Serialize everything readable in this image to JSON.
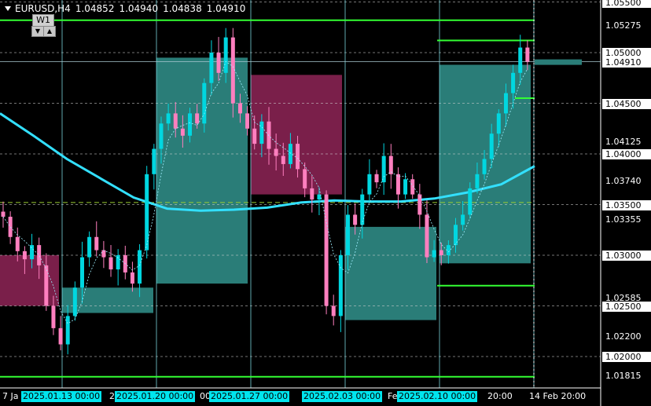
{
  "header": {
    "symbol": "EURUSD,H4",
    "open": "1.04852",
    "high": "1.04940",
    "low": "1.04838",
    "close": "1.04910"
  },
  "timeframe_box": {
    "label": "W1",
    "down_icon": "▼",
    "up_icon": "▲"
  },
  "price_scale": {
    "labels": [
      {
        "text": "1.05500",
        "boxed": true
      },
      {
        "text": "1.05275",
        "boxed": false
      },
      {
        "text": "1.05000",
        "boxed": true
      },
      {
        "text": "1.04910",
        "boxed": true,
        "current": true
      },
      {
        "text": "1.04500",
        "boxed": true
      },
      {
        "text": "1.04125",
        "boxed": false
      },
      {
        "text": "1.04000",
        "boxed": true
      },
      {
        "text": "1.03740",
        "boxed": false
      },
      {
        "text": "1.03500",
        "boxed": true
      },
      {
        "text": "1.03355",
        "boxed": false
      },
      {
        "text": "1.03000",
        "boxed": true
      },
      {
        "text": "1.02585",
        "boxed": false
      },
      {
        "text": "1.02500",
        "boxed": true
      },
      {
        "text": "1.02200",
        "boxed": false
      },
      {
        "text": "1.02000",
        "boxed": true
      },
      {
        "text": "1.01815",
        "boxed": false
      }
    ]
  },
  "time_scale": {
    "labels": [
      {
        "text": "7 Ja",
        "highlight": false
      },
      {
        "text": "2025.01.13 00:00",
        "highlight": true
      },
      {
        "text": "2",
        "highlight": false
      },
      {
        "text": "2025.01.20 00:00",
        "highlight": true
      },
      {
        "text": "00",
        "highlight": false
      },
      {
        "text": "2025.01.27 00:00",
        "highlight": true
      },
      {
        "text": "2025.02.03 00:00",
        "highlight": true
      },
      {
        "text": "Fe",
        "highlight": false
      },
      {
        "text": "2025.02.10 00:00",
        "highlight": true
      },
      {
        "text": "20:00",
        "highlight": false
      },
      {
        "text": "14 Feb 20:00",
        "highlight": false
      }
    ]
  },
  "colors": {
    "background": "#000000",
    "bull": "#00d7e0",
    "bear": "#ff7fbf",
    "bull_zone": "#2a7d78",
    "bear_zone": "#7a1f4a",
    "level_line": "#33ff33",
    "ma": "#33e0ff",
    "grid": "#ffffff"
  },
  "chart_data": {
    "type": "candlestick",
    "symbol": "EURUSD",
    "timeframe": "H4",
    "ylim": [
      1.017,
      1.0562
    ],
    "weekly_zones": [
      {
        "week": "2025.01.06",
        "open": 1.03,
        "close": 1.025,
        "direction": "bear"
      },
      {
        "week": "2025.01.13",
        "open": 1.0243,
        "close": 1.0268,
        "direction": "bull"
      },
      {
        "week": "2025.01.20",
        "open": 1.0272,
        "close": 1.0495,
        "direction": "bull"
      },
      {
        "week": "2025.01.27",
        "open": 1.0478,
        "close": 1.036,
        "direction": "bear"
      },
      {
        "week": "2025.02.03",
        "open": 1.0236,
        "close": 1.0328,
        "direction": "bull"
      },
      {
        "week": "2025.02.10",
        "open": 1.0292,
        "close": 1.0488,
        "direction": "bull"
      }
    ],
    "horizontal_levels": [
      1.0532,
      1.0512,
      1.0455,
      1.027,
      1.018
    ],
    "moving_average": [
      1.044,
      1.0418,
      1.0395,
      1.0376,
      1.0357,
      1.0346,
      1.0344,
      1.0345,
      1.0347,
      1.0352,
      1.0354,
      1.0353,
      1.0353,
      1.0356,
      1.0362,
      1.037,
      1.0388
    ],
    "close_series": [
      1.0338,
      1.0318,
      1.0304,
      1.0296,
      1.031,
      1.029,
      1.025,
      1.0228,
      1.0212,
      1.024,
      1.0268,
      1.0298,
      1.0318,
      1.0305,
      1.0298,
      1.0286,
      1.03,
      1.0283,
      1.0272,
      1.0305,
      1.038,
      1.0405,
      1.043,
      1.044,
      1.0425,
      1.0418,
      1.044,
      1.043,
      1.047,
      1.05,
      1.048,
      1.0515,
      1.045,
      1.044,
      1.0425,
      1.041,
      1.0432,
      1.0405,
      1.0398,
      1.039,
      1.041,
      1.0385,
      1.0366,
      1.0355,
      1.036,
      1.025,
      1.024,
      1.03,
      1.034,
      1.033,
      1.036,
      1.038,
      1.0372,
      1.0398,
      1.038,
      1.036,
      1.0375,
      1.036,
      1.034,
      1.0298,
      1.0305,
      1.03,
      1.031,
      1.033,
      1.034,
      1.0366,
      1.038,
      1.0395,
      1.042,
      1.044,
      1.046,
      1.048,
      1.0505,
      1.0491
    ]
  }
}
